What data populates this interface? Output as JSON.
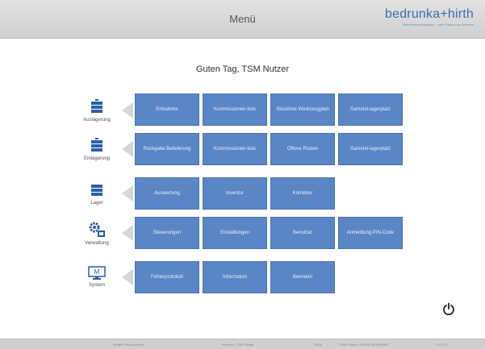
{
  "header": {
    "title": "Menü",
    "logo": "bedrunka+hirth",
    "logo_tagline": "Betriebseinrichtungen · mehr Raum zum Arbeiten"
  },
  "greeting": "Guten Tag, TSM Nutzer",
  "sections": [
    {
      "label": "Auslagerung",
      "icon": "stack-icon"
    },
    {
      "label": "Einlagerung",
      "icon": "stack-icon"
    },
    {
      "label": "Lager",
      "icon": "stack-icon"
    },
    {
      "label": "Verwaltung",
      "icon": "gears-icon"
    },
    {
      "label": "System",
      "icon": "monitor-icon",
      "icon_text": "M"
    }
  ],
  "tiles": {
    "r0": [
      "Entnahme",
      "Kommissionier-liste",
      "Stückliste Werkzeugplan",
      "Sammel-lagerplatz"
    ],
    "r1": [
      "Rückgabe Belieferung",
      "Kommissionier-liste",
      "Offene Posten",
      "Sammel-lagerplatz"
    ],
    "r2": [
      "Auswertung",
      "Inventur",
      "Korrektur"
    ],
    "r3": [
      "Steuerungen",
      "Einstellungen",
      "Benutzer",
      "Anmeldung PIN-Code"
    ],
    "r4": [
      "Fehlerprotokoll",
      "Information",
      "Beenden"
    ]
  },
  "footer": [
    "Modell: Fahrgutspezifi",
    "Benutzer: TSM Nutzer",
    "0003",
    "TSM Terminal N4CSM 6C4949807",
    "V3.0.2.0"
  ]
}
